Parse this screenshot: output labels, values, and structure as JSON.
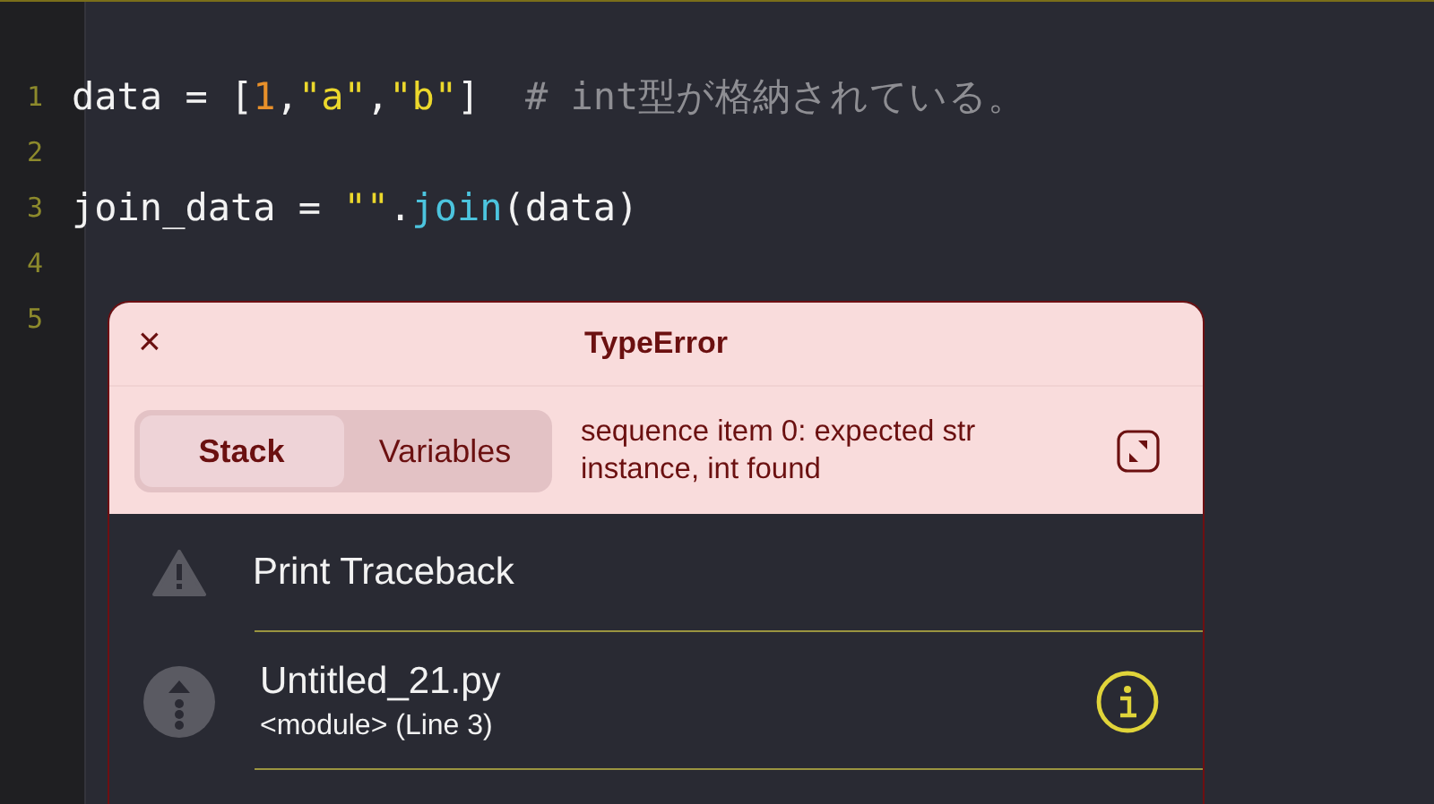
{
  "editor": {
    "lines": [
      {
        "number": "1",
        "tokens": [
          {
            "kind": "plain",
            "text": "data = ["
          },
          {
            "kind": "number",
            "text": "1"
          },
          {
            "kind": "plain",
            "text": ","
          },
          {
            "kind": "string",
            "text": "\"a\""
          },
          {
            "kind": "plain",
            "text": ","
          },
          {
            "kind": "string",
            "text": "\"b\""
          },
          {
            "kind": "plain",
            "text": "]  "
          },
          {
            "kind": "comment",
            "text": "# int型が格納されている。"
          }
        ]
      },
      {
        "number": "2"
      },
      {
        "number": "3",
        "tokens": [
          {
            "kind": "plain",
            "text": "join_data = "
          },
          {
            "kind": "string",
            "text": "\"\""
          },
          {
            "kind": "plain",
            "text": "."
          },
          {
            "kind": "func",
            "text": "join"
          },
          {
            "kind": "plain",
            "text": "(data)"
          }
        ]
      },
      {
        "number": "4"
      },
      {
        "number": "5"
      }
    ]
  },
  "error_popup": {
    "close": "×",
    "title": "TypeError",
    "tabs": [
      {
        "label": "Stack",
        "selected": true
      },
      {
        "label": "Variables",
        "selected": false
      }
    ],
    "message": "sequence item 0: expected str instance, int found",
    "rows": [
      {
        "kind": "action",
        "title": "Print Traceback"
      },
      {
        "kind": "frame",
        "title": "Untitled_21.py",
        "subtitle": "<module> (Line 3)"
      }
    ]
  }
}
